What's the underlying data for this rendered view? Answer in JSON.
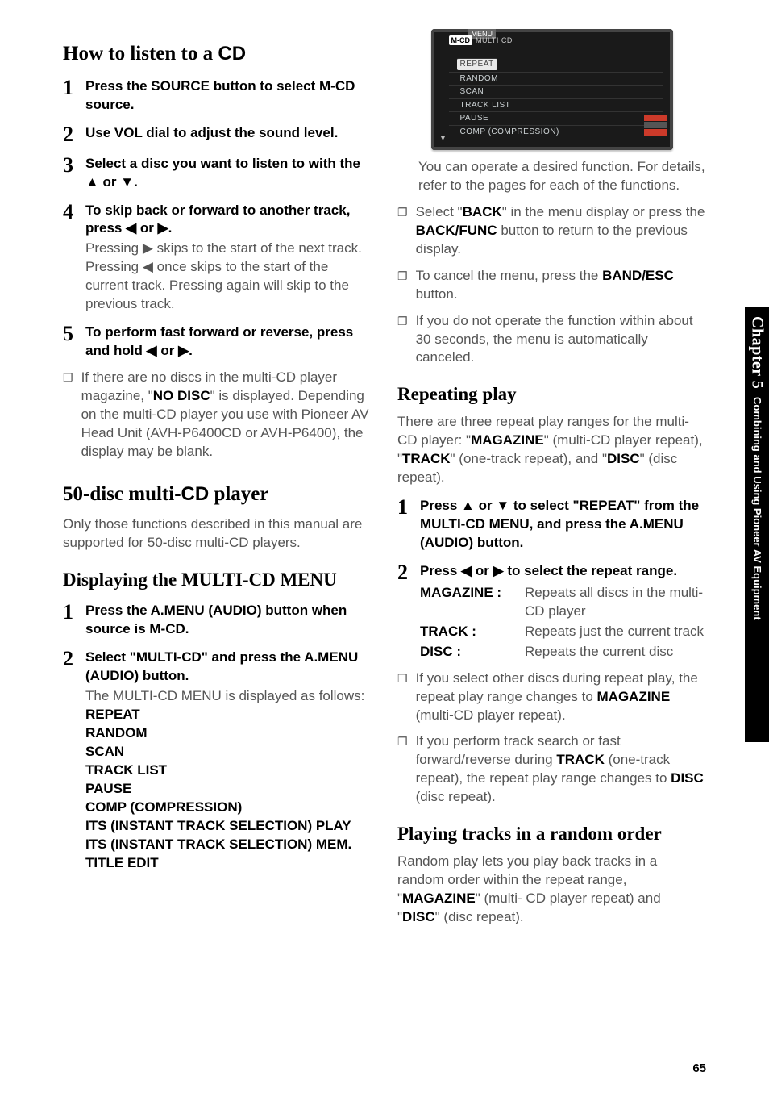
{
  "sideTab": {
    "chapter": "Chapter 5",
    "subtitle": "Combining and Using Pioneer AV Equipment"
  },
  "pageNumber": "65",
  "screenshot": {
    "topLabel": "MENU",
    "badge": "M-CD",
    "sub": "MULTI CD",
    "items": [
      "REPEAT",
      "RANDOM",
      "SCAN",
      "TRACK LIST",
      "PAUSE",
      "COMP (COMPRESSION)"
    ]
  },
  "left": {
    "h1_a": "How to listen to a ",
    "h1_b": "CD",
    "steps": [
      {
        "n": "1",
        "bold_a": "Press the ",
        "bold_s": "SOURCE",
        "bold_b": " button to select ",
        "bold_s2": "M-CD",
        "bold_c": " source."
      },
      {
        "n": "2",
        "bold_a": "Use ",
        "bold_s": "VOL",
        "bold_b": " dial to adjust the sound level."
      },
      {
        "n": "3",
        "bold_a": "Select a disc you want to listen to with the ▲ or ▼."
      },
      {
        "n": "4",
        "bold_a": "To skip back or forward to another track, press ◀ or ▶.",
        "detail": "Pressing ▶ skips to the start of the next track. Pressing ◀ once skips to the start of the current track. Pressing again will skip to the previous track."
      },
      {
        "n": "5",
        "bold_a": "To perform fast forward or reverse, press and hold ◀ or ▶."
      }
    ],
    "note1_a": "If there are no discs in the multi-CD player magazine, \"",
    "note1_s": "NO DISC",
    "note1_b": "\" is displayed. Depending on the multi-CD player you use with Pioneer AV Head Unit (AVH-P6400CD or AVH-P6400), the display may be blank.",
    "h2_a": "50-disc multi-",
    "h2_b": "CD",
    "h2_c": " player",
    "p2": "Only those functions described in this manual are supported for 50-disc multi-CD players.",
    "h3": "Displaying the MULTI-CD MENU",
    "dsteps": [
      {
        "n": "1",
        "bold": "Press the A.MENU (AUDIO) button when source is M-CD."
      },
      {
        "n": "2",
        "bold": "Select \"MULTI-CD\" and press the A.MENU (AUDIO) button.",
        "detail": "The MULTI-CD MENU is displayed as follows:"
      }
    ],
    "menuItems": [
      "REPEAT",
      "RANDOM",
      "SCAN",
      "TRACK LIST",
      "PAUSE",
      "COMP (COMPRESSION)",
      "ITS (INSTANT TRACK SELECTION) PLAY",
      "ITS (INSTANT TRACK SELECTION) MEM.",
      "TITLE EDIT"
    ]
  },
  "right": {
    "p1": "You can operate a desired function. For details, refer to the pages for each of the functions.",
    "b1_a": "Select \"",
    "b1_s": "BACK",
    "b1_b": "\" in the menu display or press the ",
    "b1_s2": "BACK/FUNC",
    "b1_c": " button to return to the previous display.",
    "b2_a": "To cancel the menu, press the ",
    "b2_s": "BAND/ESC",
    "b2_b": " button.",
    "b3": "If you do not operate the function within about 30 seconds, the menu is automatically canceled.",
    "h_repeat": "Repeating play",
    "rp_a": "There are three repeat play ranges for the multi-CD player: \"",
    "rp_s1": "MAGAZINE",
    "rp_b": "\" (multi-CD player repeat), \"",
    "rp_s2": "TRACK",
    "rp_c": "\" (one-track repeat), and \"",
    "rp_s3": "DISC",
    "rp_d": "\" (disc repeat).",
    "rsteps": [
      {
        "n": "1",
        "bold": "Press ▲ or ▼ to select \"REPEAT\" from the MULTI-CD MENU, and press the A.MENU (AUDIO) button."
      },
      {
        "n": "2",
        "bold": "Press ◀ or ▶ to select the repeat range."
      }
    ],
    "defs": [
      {
        "t": "MAGAZINE :",
        "d": "Repeats all discs in the multi-CD player"
      },
      {
        "t": "TRACK :",
        "d": "Repeats just the current track"
      },
      {
        "t": "DISC :",
        "d": "Repeats the current disc"
      }
    ],
    "rb1_a": "If you select other discs during repeat play, the repeat play range changes to ",
    "rb1_s": "MAGAZINE",
    "rb1_b": " (multi-CD player repeat).",
    "rb2_a": "If you perform track search or fast forward/reverse during ",
    "rb2_s": "TRACK",
    "rb2_b": " (one-track repeat), the repeat play range changes to ",
    "rb2_s2": "DISC",
    "rb2_c": " (disc repeat).",
    "h_random": "Playing tracks in a random order",
    "pr_a": "Random play lets you play back tracks in a random order within the repeat range, \"",
    "pr_s1": "MAGAZINE",
    "pr_b": "\" (multi- CD player repeat) and \"",
    "pr_s2": "DISC",
    "pr_c": "\" (disc repeat)."
  }
}
